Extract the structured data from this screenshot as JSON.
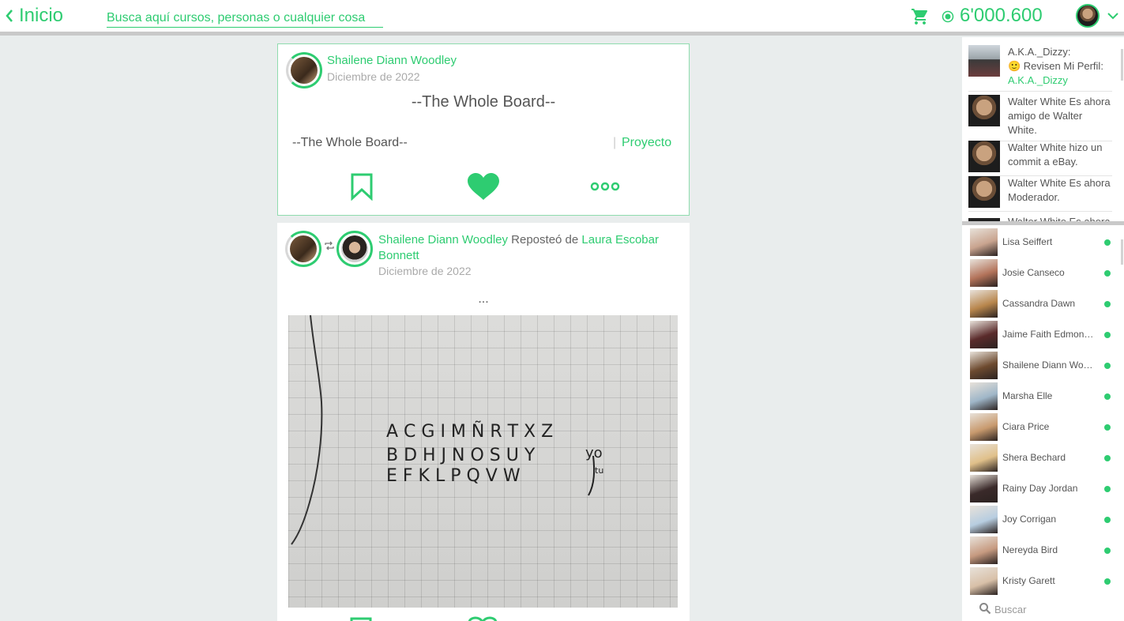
{
  "header": {
    "back_label": "Inicio",
    "search_placeholder": "Busca aquí cursos, personas o cualquier cosa",
    "coins": "6'000.600"
  },
  "posts": [
    {
      "author": "Shailene Diann Woodley",
      "date": "Diciembre de 2022",
      "title": "--The Whole Board--",
      "body": "--The Whole Board--",
      "category": "Proyecto"
    },
    {
      "author": "Shailene Diann Woodley",
      "repost_text": " Reposteó de ",
      "original_author": "Laura Escobar Bonnett",
      "date": "Diciembre de 2022",
      "caption": "...",
      "image_text": {
        "row1": "A C G I M Ñ R T X Z",
        "row2": "B D H J N O S U Y",
        "row3": "E F K L P Q V W",
        "note": "yo",
        "note2": "tu"
      }
    }
  ],
  "activity": [
    {
      "user": "A.K.A._Dizzy:",
      "text": "🙂 Revisen Mi Perfil:",
      "link": "A.K.A._Dizzy"
    },
    {
      "text": "Walter White Es ahora amigo de Walter White."
    },
    {
      "text": "Walter White hizo un commit a eBay."
    },
    {
      "text": "Walter White Es ahora Moderador."
    },
    {
      "text": "Walter White Es ahora"
    }
  ],
  "contacts": [
    {
      "name": "Lisa Seiffert",
      "color": "#c9a48f"
    },
    {
      "name": "Josie Canseco",
      "color": "#b3735a"
    },
    {
      "name": "Cassandra Dawn",
      "color": "#b8864c"
    },
    {
      "name": "Jaime Faith Edmondson",
      "color": "#5a2b2b"
    },
    {
      "name": "Shailene Diann Woodley",
      "color": "#6d4a2f"
    },
    {
      "name": "Marsha Elle",
      "color": "#9fb6c8"
    },
    {
      "name": "Ciara Price",
      "color": "#c89a6e"
    },
    {
      "name": "Shera Bechard",
      "color": "#e0c08a"
    },
    {
      "name": "Rainy Day Jordan",
      "color": "#3a2a2a"
    },
    {
      "name": "Joy Corrigan",
      "color": "#b7cde0"
    },
    {
      "name": "Nereyda Bird",
      "color": "#c69a80"
    },
    {
      "name": "Kristy Garett",
      "color": "#d8c0a8"
    }
  ],
  "contacts_search_placeholder": "Buscar",
  "colors": {
    "accent": "#2ecc71",
    "background": "#e9eded"
  }
}
